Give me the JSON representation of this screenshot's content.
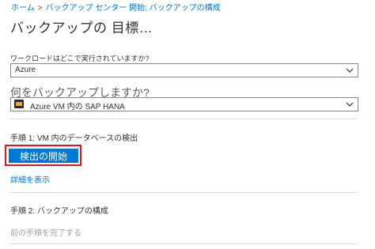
{
  "breadcrumb": {
    "items": [
      "ホーム",
      "バックアップ センター 開始: バックアップの構成"
    ]
  },
  "page": {
    "title": "バックアップの 目標…"
  },
  "workload": {
    "label": "ワークロードはどこで実行されていますか?",
    "value": "Azure"
  },
  "backup_target": {
    "label": "何をバックアップしますか?",
    "value": "Azure VM 内の SAP HANA",
    "icon": "sap-hana-icon"
  },
  "step1": {
    "label": "手順 1: VM 内のデータベースの検出",
    "button_label": "検出の開始",
    "details_link": "詳細を表示"
  },
  "step2": {
    "label": "手順 2: バックアップの構成",
    "disabled_text": "前の手順を完了する"
  },
  "colors": {
    "accent": "#0078d4",
    "highlight": "#e81123"
  }
}
